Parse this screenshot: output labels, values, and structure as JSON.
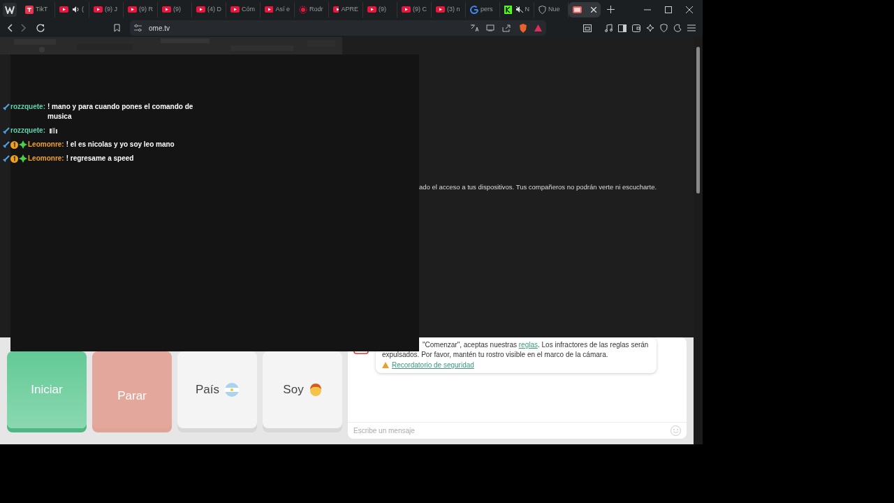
{
  "browser": {
    "tabs": [
      {
        "kind": "tiktok",
        "speaker": false,
        "title": "TikT",
        "selected": false
      },
      {
        "kind": "youtube",
        "speaker": true,
        "muted": false,
        "title": "(",
        "selected": false
      },
      {
        "kind": "youtube",
        "speaker": false,
        "title": "(9) J",
        "selected": false
      },
      {
        "kind": "youtube",
        "speaker": false,
        "title": "(9) R",
        "selected": false
      },
      {
        "kind": "youtube",
        "speaker": false,
        "title": "(9)",
        "selected": false
      },
      {
        "kind": "youtube",
        "speaker": false,
        "title": "(4) D",
        "selected": false
      },
      {
        "kind": "youtube",
        "speaker": false,
        "title": "Cóm",
        "selected": false
      },
      {
        "kind": "youtube",
        "speaker": false,
        "title": "Así e",
        "selected": false
      },
      {
        "kind": "ring",
        "speaker": false,
        "title": "Rodr",
        "selected": false
      },
      {
        "kind": "youtube",
        "speaker": false,
        "title": "APRE",
        "selected": false
      },
      {
        "kind": "youtube",
        "speaker": false,
        "title": "(9)",
        "selected": false
      },
      {
        "kind": "youtube",
        "speaker": false,
        "title": "(9) C",
        "selected": false
      },
      {
        "kind": "youtube",
        "speaker": false,
        "title": "(3) n",
        "selected": false
      },
      {
        "kind": "google",
        "speaker": false,
        "title": "pers",
        "selected": false
      },
      {
        "kind": "kick",
        "speaker": true,
        "muted": true,
        "title": "N",
        "selected": false
      },
      {
        "kind": "shield",
        "speaker": false,
        "title": "Nue",
        "selected": false
      },
      {
        "kind": "ometv",
        "speaker": false,
        "selected": true
      }
    ],
    "address": "ome.tv"
  },
  "page": {
    "camera_notice": "ado el acceso a tus dispositivos. Tus compañeros no podrán verte ni escucharte.",
    "buttons": [
      {
        "kind": "start",
        "label": "Iniciar"
      },
      {
        "kind": "stop",
        "label": "Parar"
      },
      {
        "kind": "country",
        "label": "País"
      },
      {
        "kind": "gender",
        "label": "Soy"
      }
    ],
    "rules": {
      "before": "\"Comenzar\", aceptas nuestras ",
      "link": "reglas",
      "after": ". Los infractores de las reglas serán expulsados. Por favor, mantén tu rostro visible en el marco de la cámara.",
      "safety_link": "Recordatorio de seguridad"
    },
    "message_placeholder": "Escribe un mensaje"
  },
  "chat_overlay": {
    "messages": [
      {
        "badges": [
          {
            "kind": "sword"
          }
        ],
        "user": "rozzquete:",
        "color": "#5fd3b0",
        "text": "! mano y para cuando pones el comando de musica"
      },
      {
        "badges": [
          {
            "kind": "sword"
          }
        ],
        "user": "rozzquete:",
        "color": "#5fd3b0",
        "emote": true
      },
      {
        "badges": [
          {
            "kind": "sword"
          },
          {
            "kind": "one"
          },
          {
            "kind": "plus"
          }
        ],
        "user": "Leomonre:",
        "color": "#f0a030",
        "text": "! el es nicolas y yo soy leo mano"
      },
      {
        "badges": [
          {
            "kind": "sword"
          },
          {
            "kind": "one"
          },
          {
            "kind": "plus"
          }
        ],
        "user": "Leomonre:",
        "color": "#f0a030",
        "text": "! regresame a speed"
      }
    ]
  }
}
